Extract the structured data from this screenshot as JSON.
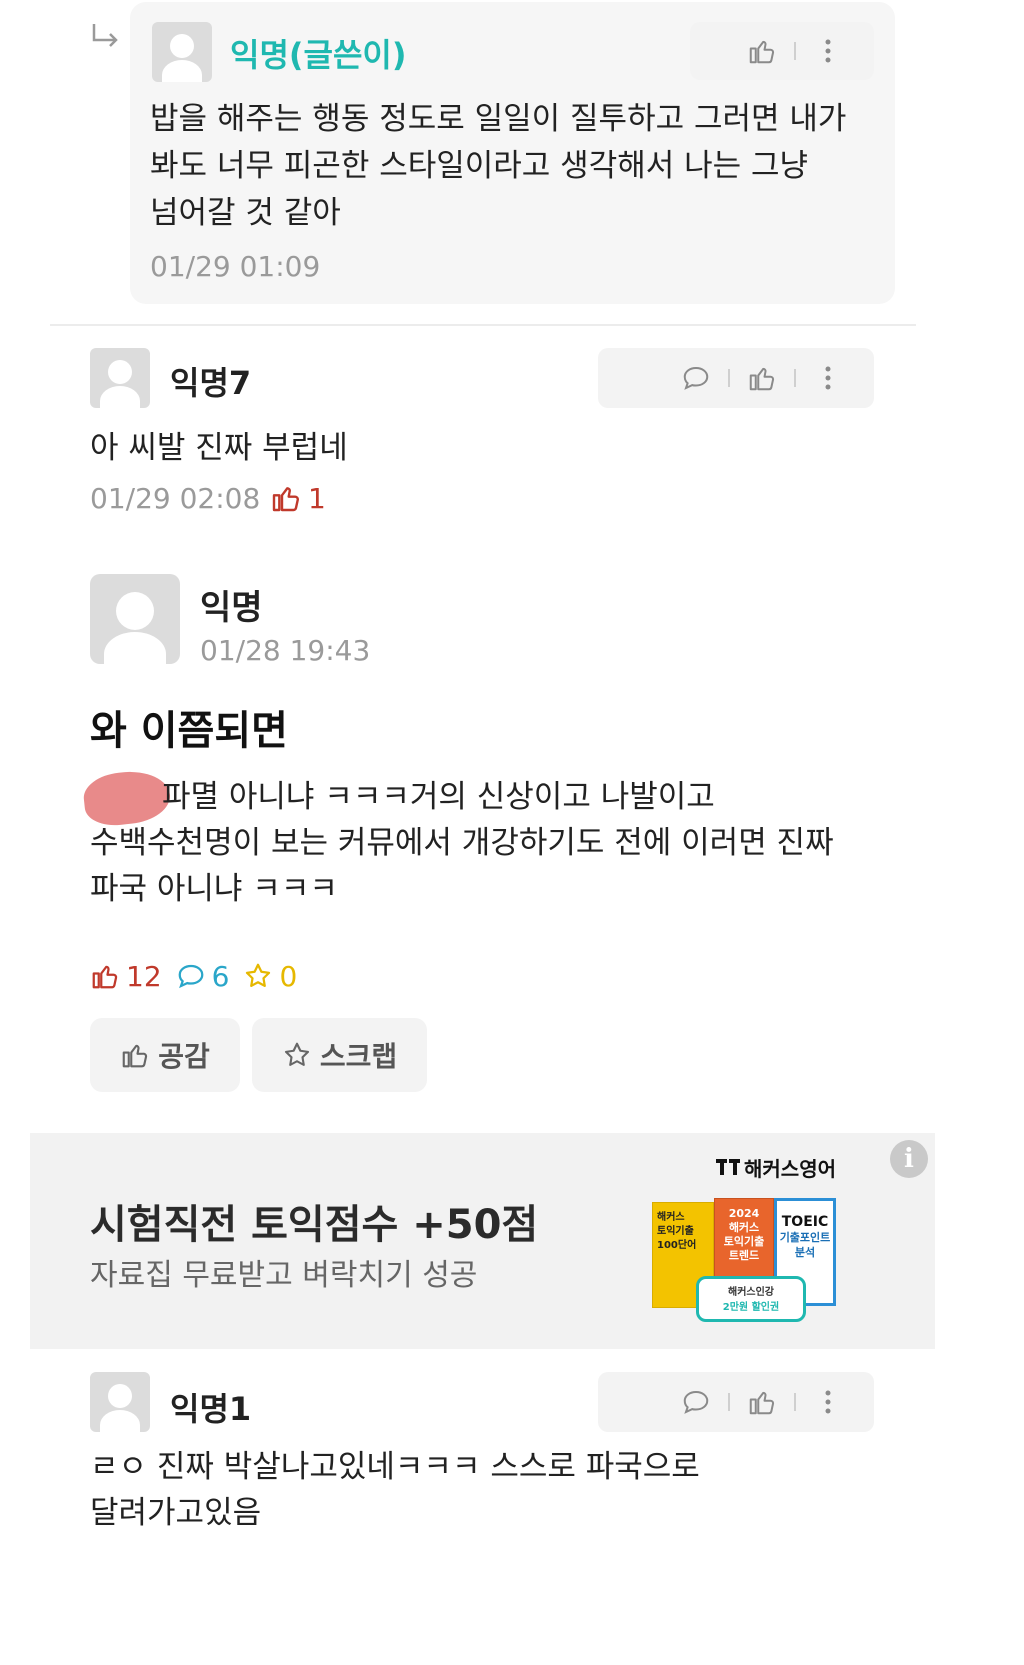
{
  "reply": {
    "author": "익명(글쓴이)",
    "text_lines": [
      "밥을 해주는 행동 정도로 일일이 질투하고 그러면 내가",
      "봐도 너무 피곤한 스타일이라고 생각해서 나는 그냥",
      "넘어갈 것 같아"
    ],
    "time": "01/29 01:09"
  },
  "comment7": {
    "author": "익명7",
    "text": "아 씨발 진짜 부럽네",
    "time": "01/29 02:08",
    "likes": "1"
  },
  "post": {
    "author": "익명",
    "time": "01/28 19:43",
    "title": "와 이쯤되면",
    "body_lines": [
      "파멸 아니냐 ㅋㅋㅋ거의 신상이고 나발이고",
      "수백수천명이 보는 커뮤에서 개강하기도 전에 이러면 진짜",
      "파국 아니냐 ㅋㅋㅋ"
    ],
    "like_count": "12",
    "comment_count": "6",
    "scrap_count": "0",
    "like_button": "공감",
    "scrap_button": "스크랩"
  },
  "ad": {
    "brand": "해커스영어",
    "headline": "시험직전 토익점수 +50점",
    "subline": "자료집 무료받고 벼락치기 성공",
    "book1_lines": [
      "해커스",
      "토익기출",
      "100단어"
    ],
    "book2_lines": [
      "2024",
      "해커스",
      "토익기출",
      "트렌드"
    ],
    "book3_lines": [
      "TOEIC",
      "기출포인트",
      "분석"
    ],
    "coupon_lines": [
      "해커스인강",
      "2만원 할인권"
    ]
  },
  "comment1": {
    "author": "익명1",
    "text_lines": [
      "ㄹㅇ 진짜 박살나고있네ㅋㅋㅋ 스스로 파국으로",
      "달려가고있음"
    ]
  },
  "colors": {
    "author_writer": "#1fb8b0",
    "like_red": "#c0392b",
    "comment_blue": "#2aa6c9",
    "scrap_yellow": "#f1c40f",
    "muted": "#9a9a9a"
  }
}
